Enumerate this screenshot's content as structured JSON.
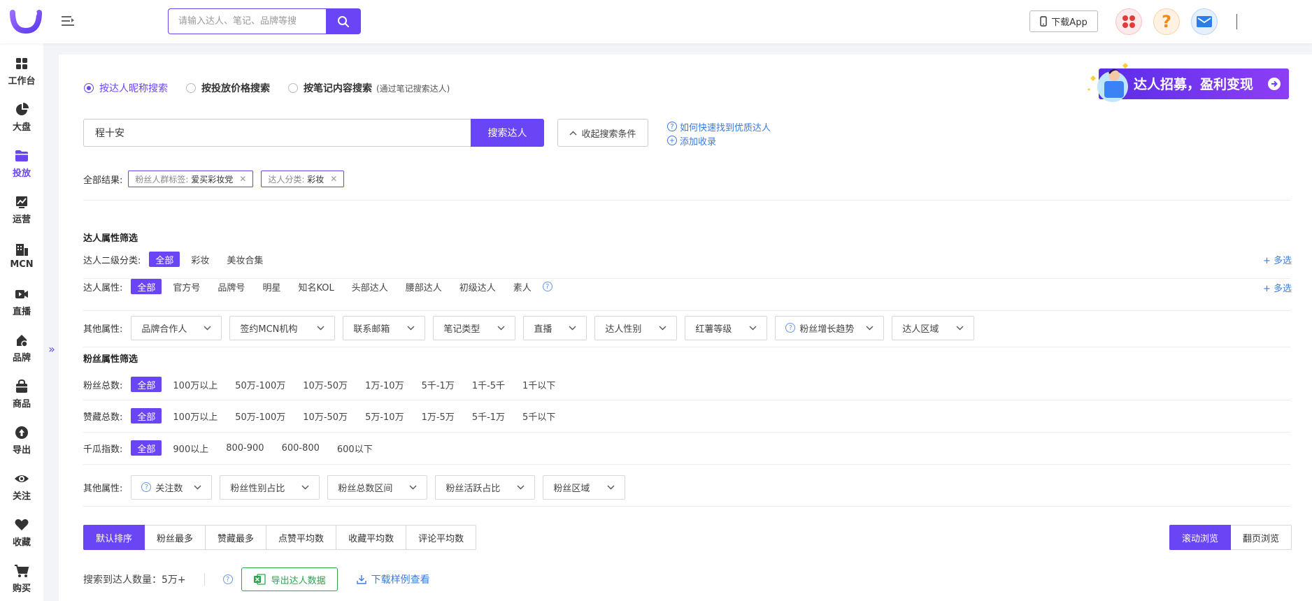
{
  "header": {
    "search_placeholder": "请输入达人、笔记、品牌等搜",
    "download_app": "下载App"
  },
  "sidebar": {
    "items": [
      {
        "label": "工作台",
        "icon": "dashboard-icon"
      },
      {
        "label": "大盘",
        "icon": "pie-chart-icon"
      },
      {
        "label": "投放",
        "icon": "folder-icon"
      },
      {
        "label": "运营",
        "icon": "trend-chart-icon"
      },
      {
        "label": "MCN",
        "icon": "building-icon"
      },
      {
        "label": "直播",
        "icon": "video-camera-icon"
      },
      {
        "label": "品牌",
        "icon": "brand-icon"
      },
      {
        "label": "商品",
        "icon": "shopping-bag-icon"
      },
      {
        "label": "导出",
        "icon": "upload-icon"
      },
      {
        "label": "关注",
        "icon": "eye-icon"
      },
      {
        "label": "收藏",
        "icon": "heart-icon"
      },
      {
        "label": "购买",
        "icon": "cart-icon"
      }
    ],
    "active_index": 2
  },
  "search_mode": {
    "options": [
      "按达人昵称搜索",
      "按投放价格搜索",
      "按笔记内容搜索"
    ],
    "hint": "(通过笔记搜索达人)",
    "selected": 0
  },
  "banner": {
    "text": "达人招募，盈利变现"
  },
  "keyword": {
    "value": "程十安",
    "search_button": "搜索达人",
    "collapse_button": "收起搜索条件",
    "help_link": "如何快速找到优质达人",
    "add_favorite": "添加收录"
  },
  "results": {
    "label": "全部结果:",
    "chips": [
      {
        "key": "粉丝人群标签:",
        "value": "爱买彩妆党"
      },
      {
        "key": "达人分类:",
        "value": "彩妆"
      }
    ]
  },
  "creator_filters": {
    "title": "达人属性筛选",
    "sub_category": {
      "label": "达人二级分类:",
      "options": [
        "全部",
        "彩妆",
        "美妆合集"
      ],
      "more": "+ 多选"
    },
    "attributes": {
      "label": "达人属性:",
      "options": [
        "全部",
        "官方号",
        "品牌号",
        "明星",
        "知名KOL",
        "头部达人",
        "腰部达人",
        "初级达人",
        "素人"
      ],
      "more": "+ 多选"
    },
    "other": {
      "label": "其他属性:",
      "dropdowns": [
        "品牌合作人",
        "签约MCN机构",
        "联系邮箱",
        "笔记类型",
        "直播",
        "达人性别",
        "红薯等级",
        "粉丝增长趋势",
        "达人区域"
      ]
    }
  },
  "fan_filters": {
    "title": "粉丝属性筛选",
    "fans_total": {
      "label": "粉丝总数:",
      "options": [
        "全部",
        "100万以上",
        "50万-100万",
        "10万-50万",
        "1万-10万",
        "5千-1万",
        "1千-5千",
        "1千以下"
      ]
    },
    "likes_total": {
      "label": "赞藏总数:",
      "options": [
        "全部",
        "100万以上",
        "50万-100万",
        "10万-50万",
        "5万-10万",
        "1万-5万",
        "5千-1万",
        "5千以下"
      ]
    },
    "qiangua_index": {
      "label": "千瓜指数:",
      "options": [
        "全部",
        "900以上",
        "800-900",
        "600-800",
        "600以下"
      ]
    },
    "other": {
      "label": "其他属性:",
      "dropdowns": [
        "关注数",
        "粉丝性别占比",
        "粉丝总数区间",
        "粉丝活跃占比",
        "粉丝区域"
      ]
    }
  },
  "sort": {
    "options": [
      "默认排序",
      "粉丝最多",
      "赞藏最多",
      "点赞平均数",
      "收藏平均数",
      "评论平均数"
    ],
    "selected": 0
  },
  "view_mode": {
    "options": [
      "滚动浏览",
      "翻页浏览"
    ],
    "selected": 0
  },
  "summary": {
    "count_text": "搜索到达人数量：5万+",
    "export_button": "导出达人数据",
    "download_sample": "下载样例查看"
  },
  "colors": {
    "accent": "#6a45f5",
    "link": "#3a7be0",
    "export_green": "#2ea44f"
  }
}
